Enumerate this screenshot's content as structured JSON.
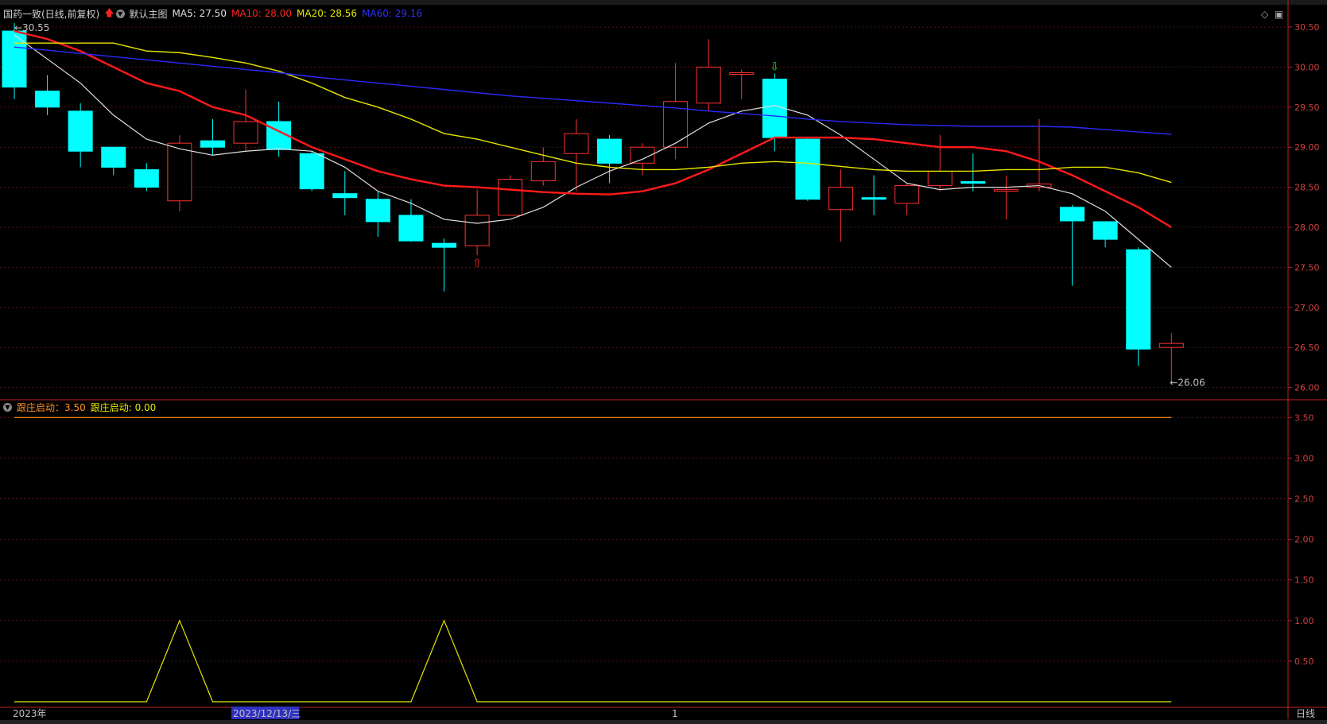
{
  "legend_main": {
    "stock": "国药一致(日线,前复权)",
    "template": "默认主图",
    "ma5": "MA5: 27.50",
    "ma10": "MA10: 28.00",
    "ma20": "MA20: 28.56",
    "ma60": "MA60: 29.16"
  },
  "legend_sub": {
    "a": "跟庄启动：3.50",
    "b": "跟庄启动: 0.00"
  },
  "labels": {
    "high": "30.55",
    "low": "26.06",
    "year": "2023年",
    "cursor_date": "2023/12/13/三",
    "marker": "1",
    "period": "日线"
  },
  "colors": {
    "up": "#ff3232",
    "down": "#00ffff",
    "ma5": "#e0e0e0",
    "ma10": "#ff1a1a",
    "ma20": "#e6e600",
    "ma60": "#2a2aff",
    "sub_line": "#e6e600",
    "sub_const": "#ff8c1a",
    "axis": "#c02020"
  },
  "chart_data": [
    {
      "type": "candlestick",
      "title": "国药一致(日线,前复权)",
      "ylim": [
        25.8,
        30.65
      ],
      "yticks": [
        26.0,
        26.5,
        27.0,
        27.5,
        28.0,
        28.5,
        29.0,
        29.5,
        30.0,
        30.5
      ],
      "ytick_labels": [
        "26.00",
        "26.50",
        "27.00",
        "27.50",
        "28.00",
        "28.50",
        "29.00",
        "29.50",
        "30.00",
        "30.50"
      ],
      "candles": [
        {
          "o": 30.45,
          "h": 30.55,
          "l": 29.6,
          "c": 29.75
        },
        {
          "o": 29.7,
          "h": 29.9,
          "l": 29.4,
          "c": 29.5
        },
        {
          "o": 29.45,
          "h": 29.55,
          "l": 28.75,
          "c": 28.95
        },
        {
          "o": 29.0,
          "h": 29.0,
          "l": 28.65,
          "c": 28.75
        },
        {
          "o": 28.72,
          "h": 28.8,
          "l": 28.45,
          "c": 28.5
        },
        {
          "o": 28.33,
          "h": 29.15,
          "l": 28.2,
          "c": 29.05
        },
        {
          "o": 29.08,
          "h": 29.35,
          "l": 28.9,
          "c": 29.0
        },
        {
          "o": 29.05,
          "h": 29.72,
          "l": 28.95,
          "c": 29.32
        },
        {
          "o": 29.32,
          "h": 29.57,
          "l": 28.88,
          "c": 28.97
        },
        {
          "o": 28.92,
          "h": 28.95,
          "l": 28.45,
          "c": 28.48
        },
        {
          "o": 28.42,
          "h": 28.7,
          "l": 28.15,
          "c": 28.37
        },
        {
          "o": 28.35,
          "h": 28.45,
          "l": 27.88,
          "c": 28.07
        },
        {
          "o": 28.15,
          "h": 28.35,
          "l": 27.82,
          "c": 27.83
        },
        {
          "o": 27.8,
          "h": 27.86,
          "l": 27.2,
          "c": 27.75
        },
        {
          "o": 27.77,
          "h": 28.47,
          "l": 27.65,
          "c": 28.15
        },
        {
          "o": 28.15,
          "h": 28.65,
          "l": 28.15,
          "c": 28.6
        },
        {
          "o": 28.58,
          "h": 29.0,
          "l": 28.52,
          "c": 28.82
        },
        {
          "o": 28.92,
          "h": 29.35,
          "l": 28.45,
          "c": 29.17
        },
        {
          "o": 29.1,
          "h": 29.15,
          "l": 28.55,
          "c": 28.8
        },
        {
          "o": 28.8,
          "h": 29.05,
          "l": 28.65,
          "c": 29.0
        },
        {
          "o": 29.0,
          "h": 30.05,
          "l": 28.85,
          "c": 29.57
        },
        {
          "o": 29.55,
          "h": 30.35,
          "l": 29.45,
          "c": 30.0
        },
        {
          "o": 29.91,
          "h": 29.97,
          "l": 29.6,
          "c": 29.93
        },
        {
          "o": 29.85,
          "h": 29.92,
          "l": 28.95,
          "c": 29.12
        },
        {
          "o": 29.1,
          "h": 29.12,
          "l": 28.33,
          "c": 28.35
        },
        {
          "o": 28.22,
          "h": 28.72,
          "l": 27.82,
          "c": 28.5
        },
        {
          "o": 28.37,
          "h": 28.65,
          "l": 28.15,
          "c": 28.35
        },
        {
          "o": 28.3,
          "h": 28.55,
          "l": 28.15,
          "c": 28.52
        },
        {
          "o": 28.52,
          "h": 29.15,
          "l": 28.45,
          "c": 28.7
        },
        {
          "o": 28.57,
          "h": 28.92,
          "l": 28.45,
          "c": 28.56
        },
        {
          "o": 28.47,
          "h": 28.65,
          "l": 28.1,
          "c": 28.47
        },
        {
          "o": 28.5,
          "h": 29.35,
          "l": 28.45,
          "c": 28.54
        },
        {
          "o": 28.25,
          "h": 28.28,
          "l": 27.27,
          "c": 28.08
        },
        {
          "o": 28.07,
          "h": 28.07,
          "l": 27.75,
          "c": 27.85
        },
        {
          "o": 27.72,
          "h": 27.75,
          "l": 26.27,
          "c": 26.48
        },
        {
          "o": 26.5,
          "h": 26.68,
          "l": 26.06,
          "c": 26.55
        }
      ],
      "series": [
        {
          "name": "MA5",
          "values": [
            30.4,
            30.1,
            29.8,
            29.4,
            29.1,
            28.98,
            28.9,
            28.95,
            28.98,
            28.95,
            28.75,
            28.45,
            28.3,
            28.1,
            28.05,
            28.1,
            28.25,
            28.5,
            28.7,
            28.85,
            29.05,
            29.3,
            29.45,
            29.52,
            29.4,
            29.15,
            28.85,
            28.55,
            28.47,
            28.5,
            28.5,
            28.52,
            28.42,
            28.2,
            27.85,
            27.5
          ]
        },
        {
          "name": "MA10",
          "values": [
            30.45,
            30.35,
            30.2,
            30.0,
            29.8,
            29.7,
            29.5,
            29.4,
            29.2,
            29.0,
            28.85,
            28.7,
            28.6,
            28.52,
            28.5,
            28.47,
            28.44,
            28.42,
            28.41,
            28.45,
            28.55,
            28.72,
            28.92,
            29.12,
            29.12,
            29.12,
            29.1,
            29.05,
            29.0,
            29.0,
            28.95,
            28.82,
            28.65,
            28.45,
            28.25,
            28.0
          ]
        },
        {
          "name": "MA20",
          "values": [
            30.3,
            30.3,
            30.3,
            30.3,
            30.2,
            30.18,
            30.12,
            30.05,
            29.95,
            29.8,
            29.62,
            29.5,
            29.35,
            29.17,
            29.1,
            29.0,
            28.9,
            28.8,
            28.75,
            28.72,
            28.72,
            28.75,
            28.8,
            28.82,
            28.8,
            28.76,
            28.72,
            28.7,
            28.7,
            28.7,
            28.72,
            28.72,
            28.75,
            28.75,
            28.68,
            28.56
          ]
        },
        {
          "name": "MA60",
          "values": [
            30.25,
            30.21,
            30.17,
            30.13,
            30.09,
            30.05,
            30.01,
            29.97,
            29.93,
            29.88,
            29.84,
            29.8,
            29.76,
            29.72,
            29.68,
            29.64,
            29.61,
            29.58,
            29.55,
            29.52,
            29.49,
            29.45,
            29.42,
            29.39,
            29.35,
            29.32,
            29.3,
            29.28,
            29.27,
            29.26,
            29.26,
            29.26,
            29.25,
            29.22,
            29.19,
            29.16
          ]
        }
      ],
      "signals": {
        "up_arrow_index": 14,
        "down_arrow_index": 23
      }
    },
    {
      "type": "line",
      "title": "跟庄启动",
      "ylim": [
        0,
        3.7
      ],
      "yticks": [
        0.5,
        1.0,
        1.5,
        2.0,
        2.5,
        3.0,
        3.5
      ],
      "ytick_labels": [
        "0.50",
        "1.00",
        "1.50",
        "2.00",
        "2.50",
        "3.00",
        "3.50"
      ],
      "series": [
        {
          "name": "跟庄启动",
          "values": [
            3.5,
            3.5,
            3.5,
            3.5,
            3.5,
            3.5,
            3.5,
            3.5,
            3.5,
            3.5,
            3.5,
            3.5,
            3.5,
            3.5,
            3.5,
            3.5,
            3.5,
            3.5,
            3.5,
            3.5,
            3.5,
            3.5,
            3.5,
            3.5,
            3.5,
            3.5,
            3.5,
            3.5,
            3.5,
            3.5,
            3.5,
            3.5,
            3.5,
            3.5,
            3.5,
            3.5
          ]
        },
        {
          "name": "跟庄启动",
          "values": [
            0,
            0,
            0,
            0,
            0,
            1,
            0,
            0,
            0,
            0,
            0,
            0,
            0,
            1,
            0,
            0,
            0,
            0,
            0,
            0,
            0,
            0,
            0,
            0,
            0,
            0,
            0,
            0,
            0,
            0,
            0,
            0,
            0,
            0,
            0,
            0
          ]
        }
      ]
    }
  ]
}
